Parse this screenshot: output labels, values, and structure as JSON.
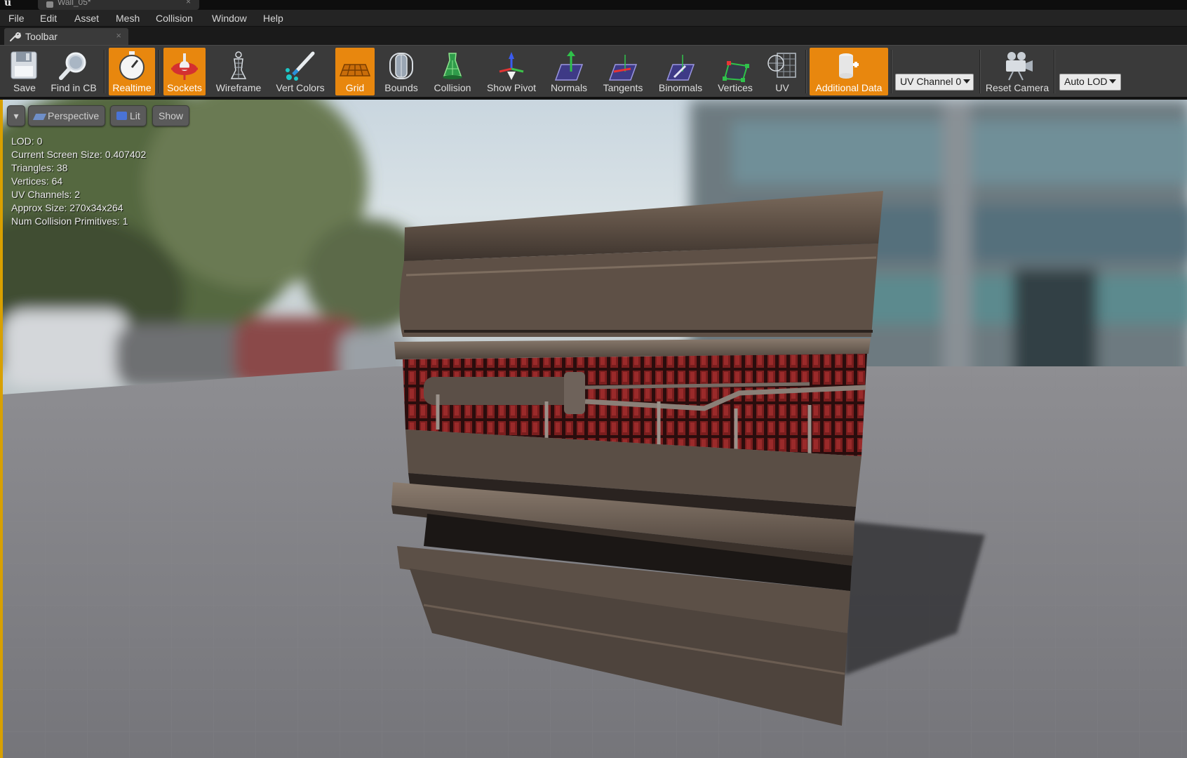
{
  "window": {
    "doc_tab_title": "Wall_05*",
    "doc_tab_close": "×"
  },
  "menu": [
    "File",
    "Edit",
    "Asset",
    "Mesh",
    "Collision",
    "Window",
    "Help"
  ],
  "panel_tab": {
    "label": "Toolbar",
    "close": "×",
    "icon": "wrench-icon"
  },
  "toolbar": {
    "buttons": [
      {
        "label": "Save",
        "icon": "save-icon",
        "active": false
      },
      {
        "label": "Find in CB",
        "icon": "find-in-cb-icon",
        "active": false
      },
      {
        "label": "Realtime",
        "icon": "realtime-icon",
        "active": true
      },
      {
        "label": "Sockets",
        "icon": "sockets-icon",
        "active": true
      },
      {
        "label": "Wireframe",
        "icon": "wireframe-icon",
        "active": false
      },
      {
        "label": "Vert Colors",
        "icon": "vert-colors-icon",
        "active": false
      },
      {
        "label": "Grid",
        "icon": "grid-icon",
        "active": true
      },
      {
        "label": "Bounds",
        "icon": "bounds-icon",
        "active": false
      },
      {
        "label": "Collision",
        "icon": "collision-icon",
        "active": false
      },
      {
        "label": "Show Pivot",
        "icon": "show-pivot-icon",
        "active": false
      },
      {
        "label": "Normals",
        "icon": "normals-icon",
        "active": false
      },
      {
        "label": "Tangents",
        "icon": "tangents-icon",
        "active": false
      },
      {
        "label": "Binormals",
        "icon": "binormals-icon",
        "active": false
      },
      {
        "label": "Vertices",
        "icon": "vertices-icon",
        "active": false
      },
      {
        "label": "UV",
        "icon": "uv-icon",
        "active": false
      },
      {
        "label": "Additional Data",
        "icon": "additional-data-icon",
        "active": true
      },
      {
        "label": "Reset Camera",
        "icon": "reset-camera-icon",
        "active": false
      }
    ],
    "uv_channel": "UV Channel 0",
    "lod": "Auto LOD",
    "accent_color": "#e8870e"
  },
  "viewport": {
    "menu_button": "▾",
    "perspective": "Perspective",
    "lit": "Lit",
    "show": "Show",
    "stats": [
      {
        "key": "LOD:",
        "value": "0"
      },
      {
        "key": "Current Screen Size:",
        "value": "0.407402"
      },
      {
        "key": "Triangles:",
        "value": "38"
      },
      {
        "key": "Vertices:",
        "value": "64"
      },
      {
        "key": "UV Channels:",
        "value": "2"
      },
      {
        "key": "Approx Size:",
        "value": "270x34x264"
      },
      {
        "key": "Num Collision Primitives:",
        "value": "1"
      }
    ]
  }
}
